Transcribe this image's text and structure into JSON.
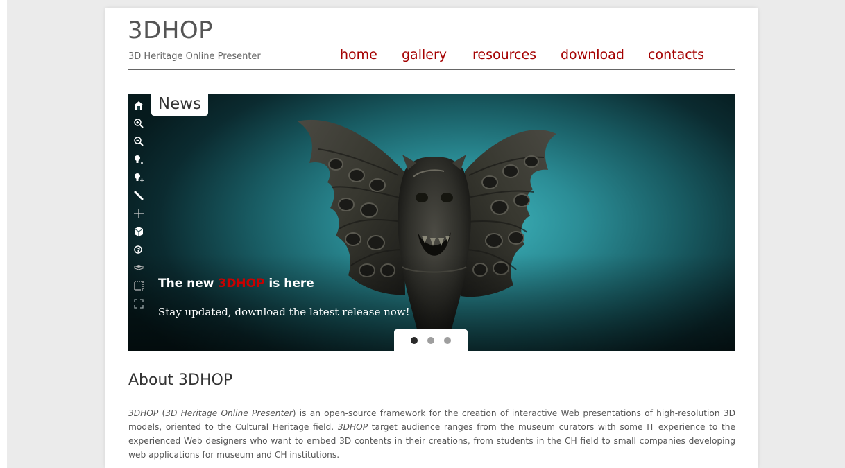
{
  "site": {
    "logo": "3DHOP",
    "tagline": "3D Heritage Online Presenter"
  },
  "nav": {
    "items": [
      {
        "label": "home"
      },
      {
        "label": "gallery"
      },
      {
        "label": "resources"
      },
      {
        "label": "download"
      },
      {
        "label": "contacts"
      }
    ]
  },
  "viewer": {
    "tab_label": "News",
    "toolbar": [
      {
        "icon": "home-icon"
      },
      {
        "icon": "zoom-in-icon"
      },
      {
        "icon": "zoom-out-icon"
      },
      {
        "icon": "light-icon"
      },
      {
        "icon": "light-plus-icon"
      },
      {
        "icon": "measure-icon"
      },
      {
        "icon": "pick-point-icon"
      },
      {
        "icon": "cube-icon"
      },
      {
        "icon": "hand-icon"
      },
      {
        "icon": "plane-section-icon"
      },
      {
        "icon": "selection-icon"
      },
      {
        "icon": "fullscreen-icon"
      }
    ],
    "slide": {
      "title_prefix": "The new ",
      "title_highlight": "3DHOP",
      "title_suffix": " is here",
      "subtitle": "Stay updated, download the latest release now!"
    },
    "dots": [
      true,
      false,
      false
    ]
  },
  "about": {
    "title": "About 3DHOP",
    "p1": "3DHOP",
    "p2": " (",
    "p3": "3D Heritage Online Presenter",
    "p4": ") is an open-source framework for the creation of interactive Web presentations of high-resolution 3D models, oriented to the Cultural Heritage field. ",
    "p5": "3DHOP",
    "p6": " target audience ranges from the museum curators with some IT experience to the experienced Web designers who want to embed 3D contents in their creations, from students in the CH field to small companies developing web applications for museum and CH institutions."
  },
  "colors": {
    "accent": "#a40000",
    "highlight": "#c90000",
    "background": "#ebebeb"
  }
}
